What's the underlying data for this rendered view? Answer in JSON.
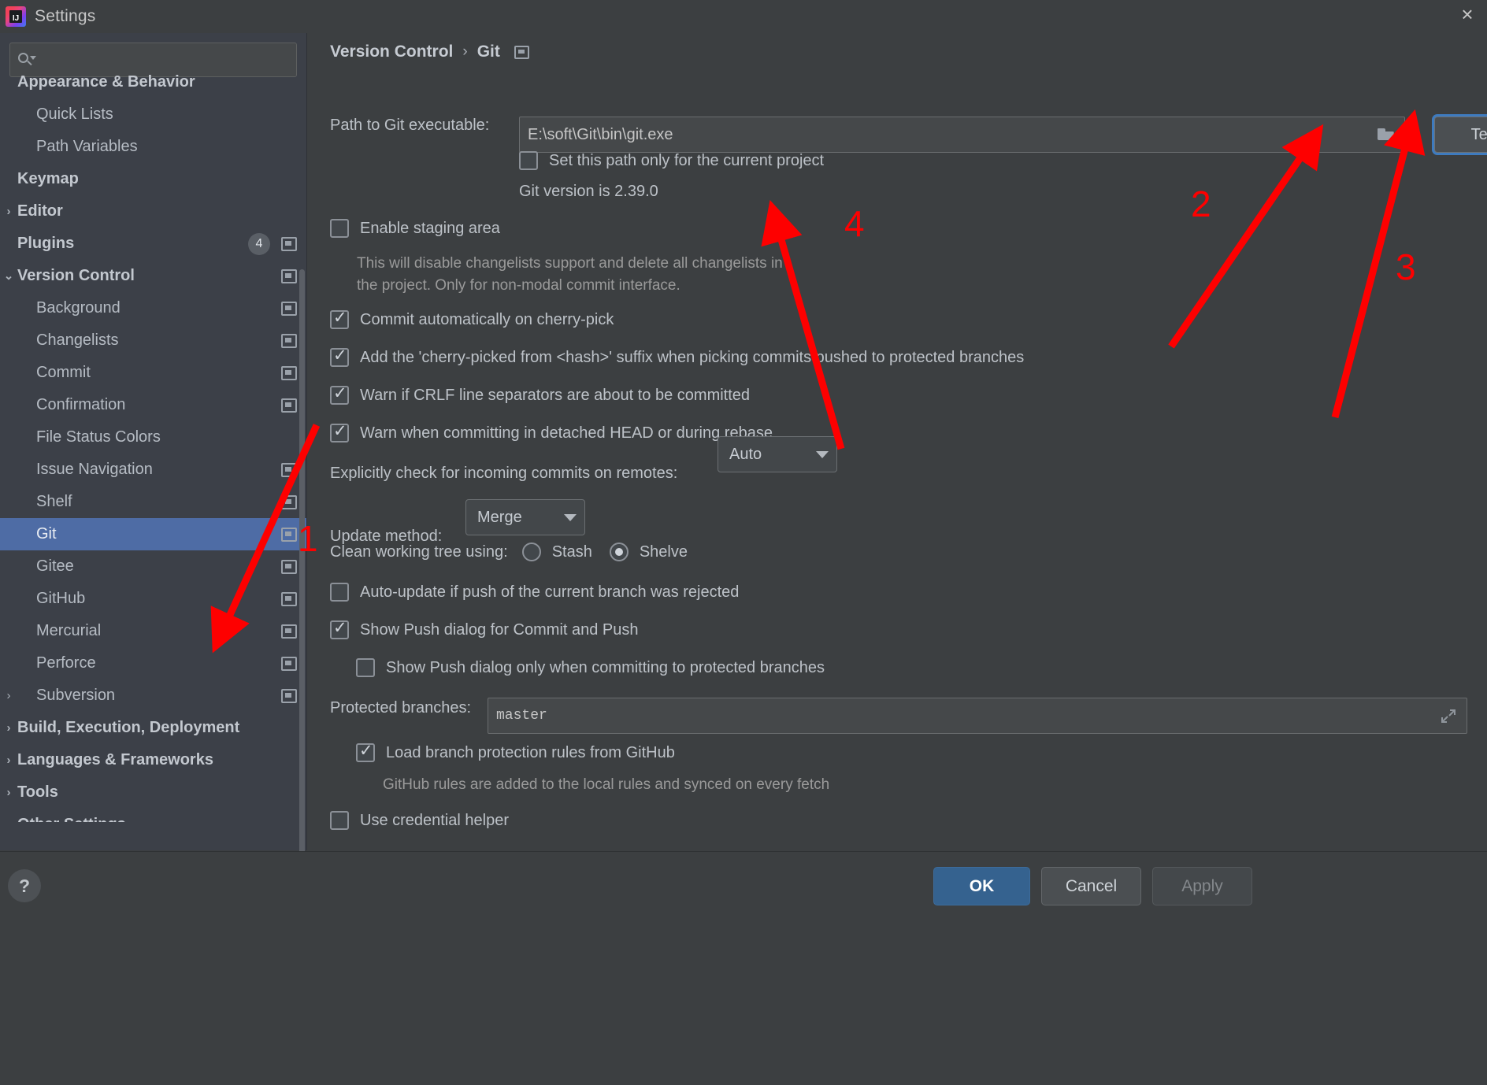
{
  "window": {
    "title": "Settings",
    "logo_text": "IJ",
    "close_label": "×"
  },
  "search": {
    "value": "",
    "placeholder": ""
  },
  "sidebar": {
    "items": [
      {
        "label": "Appearance & Behavior",
        "level": 0,
        "bold": true,
        "arrow": "",
        "cfg": false,
        "badge": ""
      },
      {
        "label": "Quick Lists",
        "level": 1,
        "bold": false,
        "arrow": "",
        "cfg": false,
        "badge": ""
      },
      {
        "label": "Path Variables",
        "level": 1,
        "bold": false,
        "arrow": "",
        "cfg": false,
        "badge": ""
      },
      {
        "label": "Keymap",
        "level": 0,
        "bold": true,
        "arrow": "",
        "cfg": false,
        "badge": ""
      },
      {
        "label": "Editor",
        "level": 0,
        "bold": true,
        "arrow": "›",
        "cfg": false,
        "badge": ""
      },
      {
        "label": "Plugins",
        "level": 0,
        "bold": true,
        "arrow": "",
        "cfg": true,
        "badge": "4"
      },
      {
        "label": "Version Control",
        "level": 0,
        "bold": true,
        "arrow": "⌄",
        "cfg": true,
        "badge": ""
      },
      {
        "label": "Background",
        "level": 1,
        "bold": false,
        "arrow": "",
        "cfg": true,
        "badge": ""
      },
      {
        "label": "Changelists",
        "level": 1,
        "bold": false,
        "arrow": "",
        "cfg": true,
        "badge": ""
      },
      {
        "label": "Commit",
        "level": 1,
        "bold": false,
        "arrow": "",
        "cfg": true,
        "badge": ""
      },
      {
        "label": "Confirmation",
        "level": 1,
        "bold": false,
        "arrow": "",
        "cfg": true,
        "badge": ""
      },
      {
        "label": "File Status Colors",
        "level": 1,
        "bold": false,
        "arrow": "",
        "cfg": false,
        "badge": ""
      },
      {
        "label": "Issue Navigation",
        "level": 1,
        "bold": false,
        "arrow": "",
        "cfg": true,
        "badge": ""
      },
      {
        "label": "Shelf",
        "level": 1,
        "bold": false,
        "arrow": "",
        "cfg": true,
        "badge": ""
      },
      {
        "label": "Git",
        "level": 1,
        "bold": false,
        "arrow": "",
        "cfg": true,
        "badge": "",
        "selected": true
      },
      {
        "label": "Gitee",
        "level": 1,
        "bold": false,
        "arrow": "",
        "cfg": true,
        "badge": ""
      },
      {
        "label": "GitHub",
        "level": 1,
        "bold": false,
        "arrow": "",
        "cfg": true,
        "badge": ""
      },
      {
        "label": "Mercurial",
        "level": 1,
        "bold": false,
        "arrow": "",
        "cfg": true,
        "badge": ""
      },
      {
        "label": "Perforce",
        "level": 1,
        "bold": false,
        "arrow": "",
        "cfg": true,
        "badge": ""
      },
      {
        "label": "Subversion",
        "level": 1,
        "bold": false,
        "arrow": "›",
        "cfg": true,
        "badge": ""
      },
      {
        "label": "Build, Execution, Deployment",
        "level": 0,
        "bold": true,
        "arrow": "›",
        "cfg": false,
        "badge": ""
      },
      {
        "label": "Languages & Frameworks",
        "level": 0,
        "bold": true,
        "arrow": "›",
        "cfg": false,
        "badge": ""
      },
      {
        "label": "Tools",
        "level": 0,
        "bold": true,
        "arrow": "›",
        "cfg": false,
        "badge": ""
      },
      {
        "label": "Other Settings",
        "level": 0,
        "bold": true,
        "arrow": "›",
        "cfg": false,
        "badge": ""
      }
    ]
  },
  "breadcrumb": {
    "root": "Version Control",
    "separator": "›",
    "current": "Git"
  },
  "git_settings": {
    "path_label": "Path to Git executable:",
    "path_value": "E:\\soft\\Git\\bin\\git.exe",
    "test_button": "Test",
    "set_path_only_label": "Set this path only for the current project",
    "git_version": "Git version is 2.39.0",
    "enable_staging_label": "Enable staging area",
    "staging_desc_line1": "This will disable changelists support and delete all changelists in",
    "staging_desc_line2": "the project. Only for non-modal commit interface.",
    "commit_cherry_pick_label": "Commit automatically on cherry-pick",
    "add_cherry_picked_suffix_label": "Add the 'cherry-picked from <hash>' suffix when picking commits pushed to protected branches",
    "warn_crlf_label": "Warn if CRLF line separators are about to be committed",
    "warn_detached_head_label": "Warn when committing in detached HEAD or during rebase",
    "incoming_commits_label": "Explicitly check for incoming commits on remotes:",
    "incoming_commits_value": "Auto",
    "update_method_label": "Update method:",
    "update_method_value": "Merge",
    "clean_tree_label": "Clean working tree using:",
    "clean_tree_stash": "Stash",
    "clean_tree_shelve": "Shelve",
    "auto_update_label": "Auto-update if push of the current branch was rejected",
    "show_push_dialog_label": "Show Push dialog for Commit and Push",
    "show_push_protected_label": "Show Push dialog only when committing to protected branches",
    "protected_branches_label": "Protected branches:",
    "protected_branches_value": "master",
    "load_branch_rules_label": "Load branch protection rules from GitHub",
    "github_rules_desc": "GitHub rules are added to the local rules and synced on every fetch",
    "use_credential_helper_label": "Use credential helper"
  },
  "annotations": [
    {
      "number": "1"
    },
    {
      "number": "2"
    },
    {
      "number": "3"
    },
    {
      "number": "4"
    }
  ],
  "footer": {
    "help_label": "?",
    "ok_label": "OK",
    "cancel_label": "Cancel",
    "apply_label": "Apply"
  },
  "colors": {
    "accent_blue": "#4e6ca5",
    "ok_button": "#35628f",
    "focus_ring": "#3e7bbf",
    "annotation_red": "#fe0000",
    "panel_bg": "#3c3f41",
    "sidebar_bg": "#3c4048"
  }
}
